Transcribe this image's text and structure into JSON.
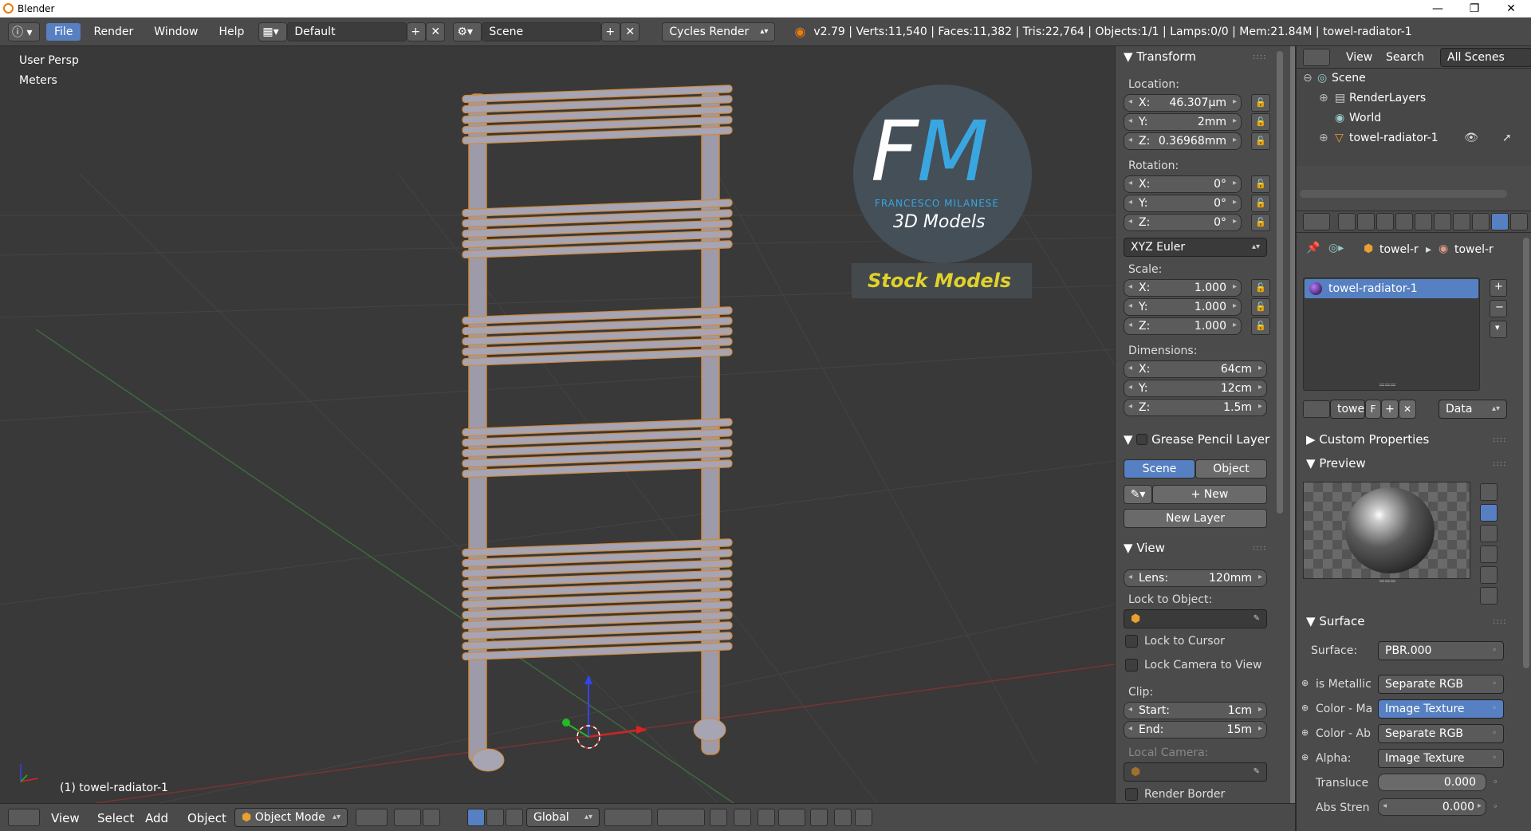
{
  "titlebar": {
    "title": "Blender",
    "minimize": "—",
    "maximize": "❐",
    "close": "✕"
  },
  "infobar": {
    "menus": [
      "File",
      "Render",
      "Window",
      "Help"
    ],
    "screen_layout": "Default",
    "scene": "Scene",
    "engine": "Cycles Render",
    "stats": "v2.79 | Verts:11,540 | Faces:11,382 | Tris:22,764 | Objects:1/1 | Lamps:0/0 | Mem:21.84M | towel-radiator-1"
  },
  "viewport": {
    "view_name": "User Persp",
    "units": "Meters",
    "object_label": "(1) towel-radiator-1",
    "logo_line1": "FM",
    "logo_line2": "FRANCESCO MILANESE",
    "logo_line3": "3D Models",
    "banner": "Stock Models"
  },
  "transform": {
    "title": "Transform",
    "location_label": "Location:",
    "location": {
      "x": "46.307µm",
      "y": "2mm",
      "z": "0.36968mm"
    },
    "rotation_label": "Rotation:",
    "rotation": {
      "x": "0°",
      "y": "0°",
      "z": "0°"
    },
    "rotation_mode": "XYZ Euler",
    "scale_label": "Scale:",
    "scale": {
      "x": "1.000",
      "y": "1.000",
      "z": "1.000"
    },
    "dimensions_label": "Dimensions:",
    "dimensions": {
      "x": "64cm",
      "y": "12cm",
      "z": "1.5m"
    },
    "xl": "X:",
    "yl": "Y:",
    "zl": "Z:"
  },
  "grease_pencil": {
    "title": "Grease Pencil Layer",
    "scene_tab": "Scene",
    "object_tab": "Object",
    "new_label": "New",
    "new_layer_label": "New Layer"
  },
  "view_panel": {
    "title": "View",
    "lens_label": "Lens:",
    "lens": "120mm",
    "lock_object_label": "Lock to Object:",
    "lock_cursor": "Lock to Cursor",
    "lock_camera": "Lock Camera to View",
    "clip_label": "Clip:",
    "start_label": "Start:",
    "start": "1cm",
    "end_label": "End:",
    "end": "15m",
    "local_camera_label": "Local Camera:",
    "render_border": "Render Border"
  },
  "outliner": {
    "view_menu": "View",
    "search_menu": "Search",
    "filter": "All Scenes",
    "items": [
      "Scene",
      "RenderLayers",
      "World",
      "towel-radiator-1"
    ]
  },
  "properties": {
    "breadcrumb1": "towel-r",
    "breadcrumb2": "towel-r",
    "material_slot": "towel-radiator-1",
    "material_name": "towel",
    "fake_user": "F",
    "link_mode": "Data",
    "custom_props": "Custom Properties",
    "preview": "Preview",
    "surface_title": "Surface",
    "surface_label": "Surface:",
    "surface_value": "PBR.000",
    "inputs": [
      {
        "label": "is Metallic",
        "value": "Separate RGB"
      },
      {
        "label": "Color - Ma",
        "value": "Image Texture"
      },
      {
        "label": "Color - Ab",
        "value": "Separate RGB"
      },
      {
        "label": "Alpha:",
        "value": "Image Texture"
      }
    ],
    "translucency_label": "Transluce",
    "translucency_value": "0.000",
    "abs_label": "Abs Stren",
    "abs_value": "0.000"
  },
  "bottombar": {
    "menus": [
      "View",
      "Select",
      "Add",
      "Object"
    ],
    "mode": "Object Mode",
    "orientation": "Global"
  },
  "colors": {
    "accent": "#5680c2",
    "viewport_bg": "#393939",
    "panel_bg": "#4b4b4b",
    "logo_blue": "#3aa6e0",
    "banner_yellow": "#e0d22a"
  }
}
